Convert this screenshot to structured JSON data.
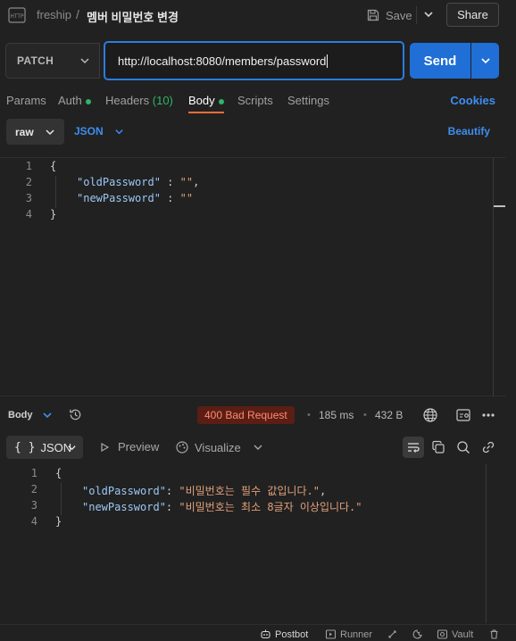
{
  "header": {
    "workspace": "freship",
    "separator": "/",
    "request_name": "멤버 비밀번호 변경",
    "save_label": "Save",
    "share_label": "Share"
  },
  "request": {
    "method": "PATCH",
    "url": "http://localhost:8080/members/password",
    "send_label": "Send"
  },
  "tabs": {
    "params": "Params",
    "auth": "Auth",
    "headers": "Headers",
    "headers_count": "(10)",
    "body": "Body",
    "scripts": "Scripts",
    "settings": "Settings",
    "cookies": "Cookies",
    "active": "Body"
  },
  "body_options": {
    "mode": "raw",
    "language": "JSON",
    "beautify": "Beautify"
  },
  "request_body": {
    "line_numbers": [
      "1",
      "2",
      "3",
      "4"
    ],
    "open": "{",
    "close": "}",
    "key1": "\"oldPassword\"",
    "value1": "\"\"",
    "key2": "\"newPassword\"",
    "value2": "\"\""
  },
  "response": {
    "label": "Body",
    "status": "400 Bad Request",
    "time": "185 ms",
    "size": "432 B",
    "format": "JSON",
    "preview": "Preview",
    "visualize": "Visualize",
    "line_numbers": [
      "1",
      "2",
      "3",
      "4"
    ],
    "open": "{",
    "close": "}",
    "key1": "\"oldPassword\"",
    "value1": "\"비밀번호는 필수 값입니다.\"",
    "key2": "\"newPassword\"",
    "value2": "\"비밀번호는 최소 8글자 이상입니다.\""
  },
  "footer": {
    "postbot": "Postbot",
    "runner": "Runner",
    "vault": "Vault"
  },
  "colors": {
    "accent": "#1f6fd6",
    "link": "#3d8ef0",
    "active_tab_underline": "#ff6c37",
    "status_error_bg": "#5a1e14",
    "status_error_text": "#ff8a70",
    "dot_green": "#2fb46a"
  }
}
